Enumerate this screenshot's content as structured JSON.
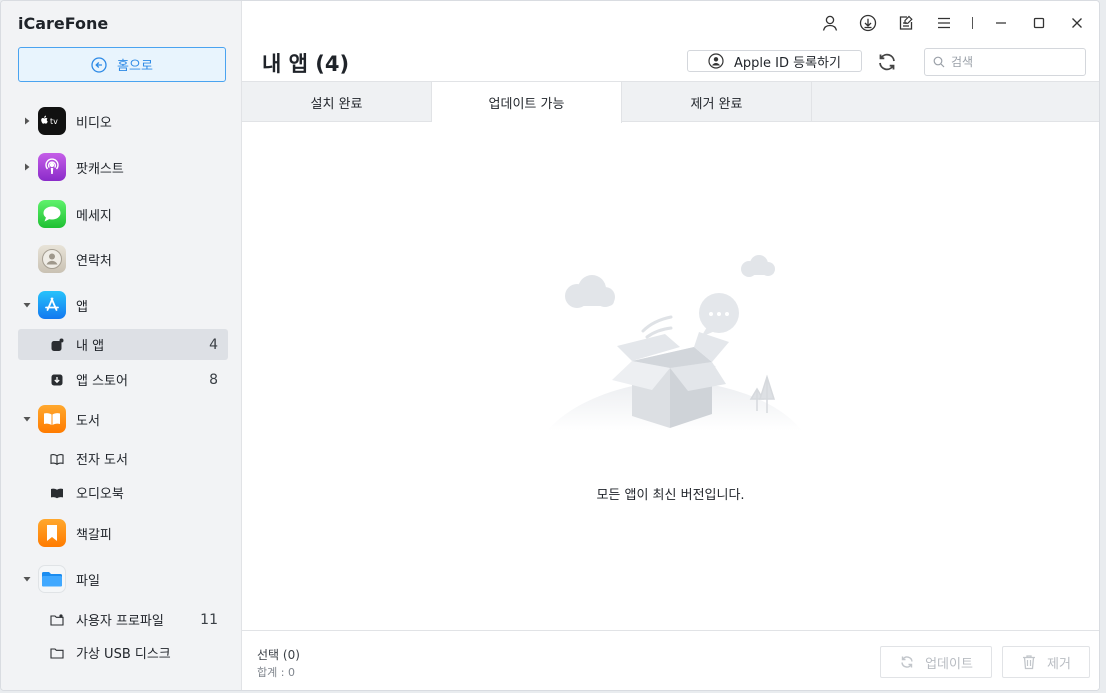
{
  "app": {
    "title": "iCareFone",
    "home_label": "홈으로"
  },
  "sidebar": {
    "categories": [
      {
        "label": "비디오"
      },
      {
        "label": "팟캐스트"
      },
      {
        "label": "메세지"
      },
      {
        "label": "연락처"
      },
      {
        "label": "앱"
      },
      {
        "label": "도서"
      },
      {
        "label": "책갈피"
      },
      {
        "label": "파일"
      }
    ],
    "apps_sub": [
      {
        "label": "내 앱",
        "count": "4"
      },
      {
        "label": "앱 스토어",
        "count": "8"
      }
    ],
    "books_sub": [
      {
        "label": "전자 도서"
      },
      {
        "label": "오디오북"
      }
    ],
    "files_sub": [
      {
        "label": "사용자 프로파일",
        "count": "11"
      },
      {
        "label": "가상 USB 디스크"
      }
    ]
  },
  "main": {
    "title": "내 앱 (4)",
    "apple_id_label": "Apple ID 등록하기",
    "search_placeholder": "검색",
    "tabs": [
      {
        "label": "설치 완료"
      },
      {
        "label": "업데이트 가능"
      },
      {
        "label": "제거 완료"
      }
    ],
    "active_tab": "업데이트 가능",
    "empty_message": "모든 앱이 최신 버전입니다."
  },
  "footer": {
    "selection": "선택 (0)",
    "total": "합계 : 0",
    "update_label": "업데이트",
    "remove_label": "제거"
  },
  "colors": {
    "accent": "#2d8ae6",
    "sidebar_bg": "#f2f3f5",
    "active_item_bg": "#dde0e5"
  }
}
